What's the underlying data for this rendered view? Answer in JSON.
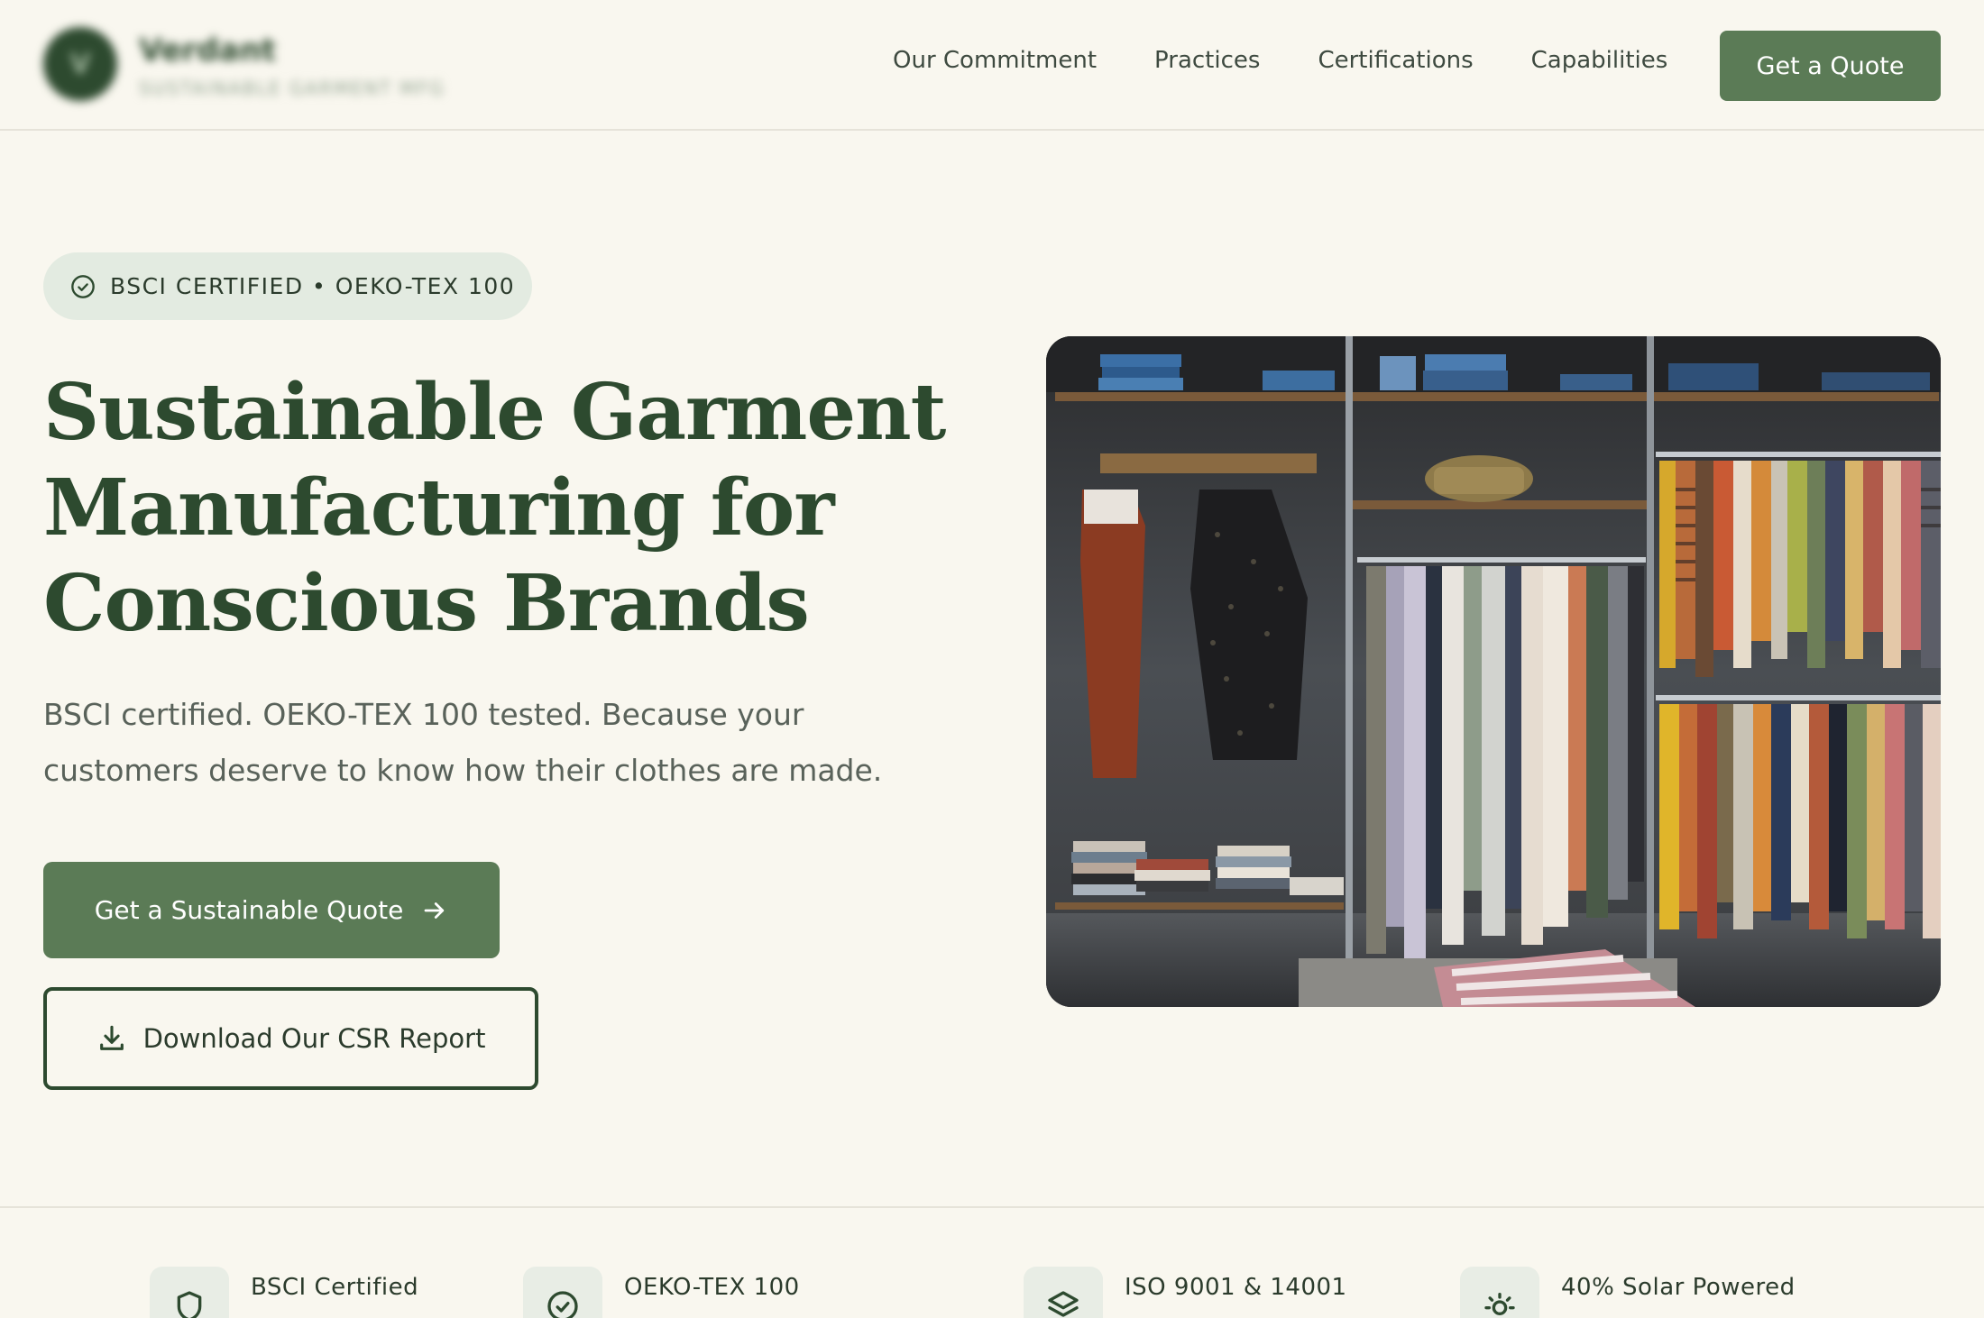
{
  "brand": {
    "name": "Verdant",
    "tagline": "SUSTAINABLE GARMENT MFG",
    "monogram": "V"
  },
  "nav": {
    "items": [
      {
        "label": "Our Commitment"
      },
      {
        "label": "Practices"
      },
      {
        "label": "Certifications"
      },
      {
        "label": "Capabilities"
      }
    ],
    "cta_label": "Get a Quote"
  },
  "hero": {
    "badge": "BSCI CERTIFIED • OEKO-TEX 100",
    "title_line1": "Sustainable Garment",
    "title_line2": "Manufacturing for",
    "title_line3": "Conscious Brands",
    "subtitle_line1": "BSCI certified. OEKO-TEX 100 tested. Because your",
    "subtitle_line2": "customers deserve to know how their clothes are made.",
    "primary_cta": "Get a Sustainable Quote",
    "secondary_cta": "Download Our CSR Report"
  },
  "features": [
    {
      "label": "BSCI Certified",
      "icon": "shield-icon"
    },
    {
      "label": "OEKO-TEX 100",
      "icon": "check-circle-icon"
    },
    {
      "label": "ISO 9001 & 14001",
      "icon": "layers-icon"
    },
    {
      "label": "40% Solar Powered",
      "icon": "sun-icon"
    }
  ],
  "colors": {
    "background": "#f9f7ef",
    "primary": "#5b7b56",
    "heading": "#2d4a2f",
    "badge_bg": "#e3ebe1"
  }
}
